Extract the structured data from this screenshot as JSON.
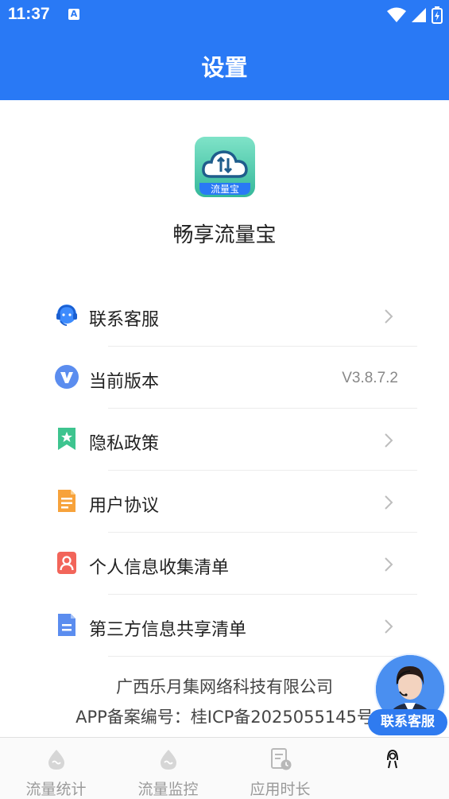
{
  "status_bar": {
    "time": "11:37",
    "notification_glyph": "A"
  },
  "header": {
    "title": "设置"
  },
  "app": {
    "logo_text": "流量宝",
    "name": "畅享流量宝"
  },
  "menu": [
    {
      "label": "联系客服",
      "icon": "headset-icon",
      "value": ""
    },
    {
      "label": "当前版本",
      "icon": "version-icon",
      "value": "V3.8.7.2"
    },
    {
      "label": "隐私政策",
      "icon": "bookmark-star-icon",
      "value": ""
    },
    {
      "label": "用户协议",
      "icon": "document-icon",
      "value": ""
    },
    {
      "label": "个人信息收集清单",
      "icon": "user-card-icon",
      "value": ""
    },
    {
      "label": "第三方信息共享清单",
      "icon": "file-icon",
      "value": ""
    }
  ],
  "footer": {
    "company": "广西乐月集网络科技有限公司",
    "icp": "APP备案编号：桂ICP备2025055145号"
  },
  "support_float": {
    "label": "联系客服"
  },
  "tabs": [
    {
      "label": "流量统计",
      "icon": "drop-icon"
    },
    {
      "label": "流量监控",
      "icon": "drop-icon"
    },
    {
      "label": "应用时长",
      "icon": "report-clock-icon"
    },
    {
      "label": "",
      "icon": "person-icon"
    }
  ],
  "colors": {
    "primary": "#2979f5",
    "divider": "#ececec",
    "text": "#222222",
    "muted": "#9a9a9a"
  }
}
